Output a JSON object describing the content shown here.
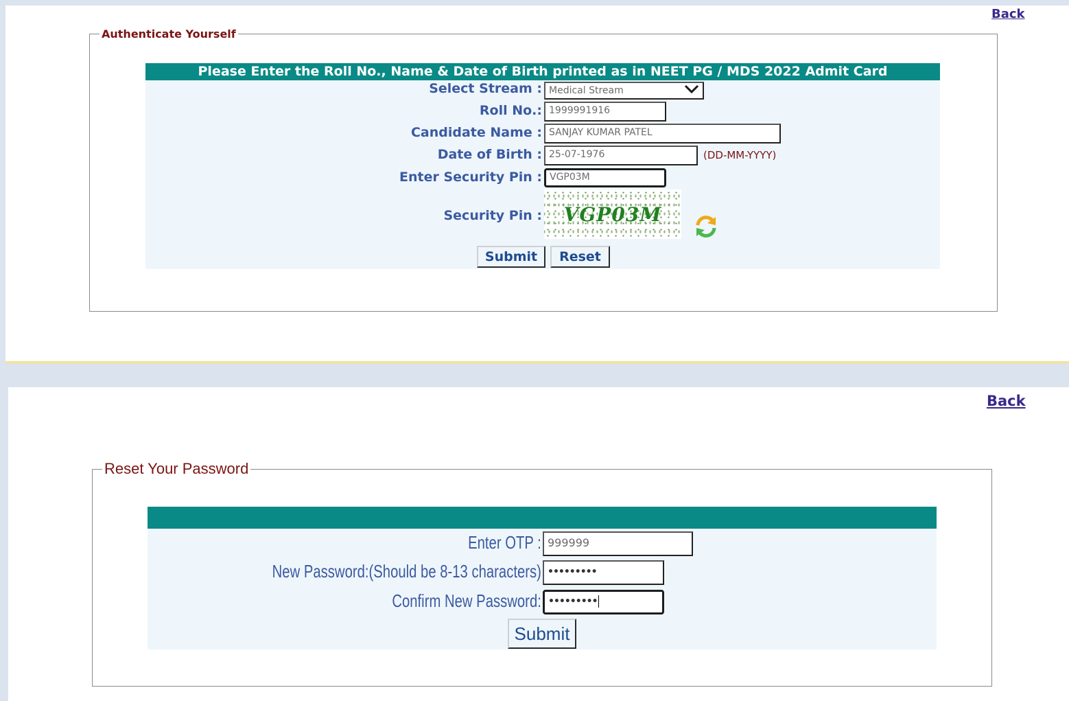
{
  "auth": {
    "back_label": "Back",
    "legend": "Authenticate Yourself",
    "banner": "Please Enter the Roll No., Name & Date of Birth printed as in NEET PG / MDS 2022  Admit Card",
    "stream_label": "Select Stream :",
    "stream_value": "Medical Stream",
    "roll_label": "Roll No.:",
    "roll_value": "1999991916",
    "name_label": "Candidate Name :",
    "name_value": "SANJAY KUMAR PATEL",
    "dob_label": "Date of Birth :",
    "dob_value": "25-07-1976",
    "dob_hint": "(DD-MM-YYYY)",
    "pin_label": "Enter Security Pin :",
    "pin_value": "VGP03M",
    "captcha_label": "Security Pin :",
    "captcha_text": "VGP03M",
    "refresh_icon": "refresh-icon",
    "submit_label": "Submit",
    "reset_label": "Reset"
  },
  "reset": {
    "back_label": "Back",
    "legend": "Reset Your Password",
    "otp_label": "Enter OTP :",
    "otp_value": "999999",
    "newpw_label": "New Password:(Should be 8-13 characters)",
    "newpw_value": "•••••••••",
    "confirm_label": "Confirm New Password:",
    "confirm_value": "•••••••••",
    "submit_label": "Submit"
  },
  "colors": {
    "teal": "#0a8a86",
    "label_blue": "#3c5aa0",
    "legend_maroon": "#7b1414",
    "panel_bg": "#eef6fc"
  }
}
